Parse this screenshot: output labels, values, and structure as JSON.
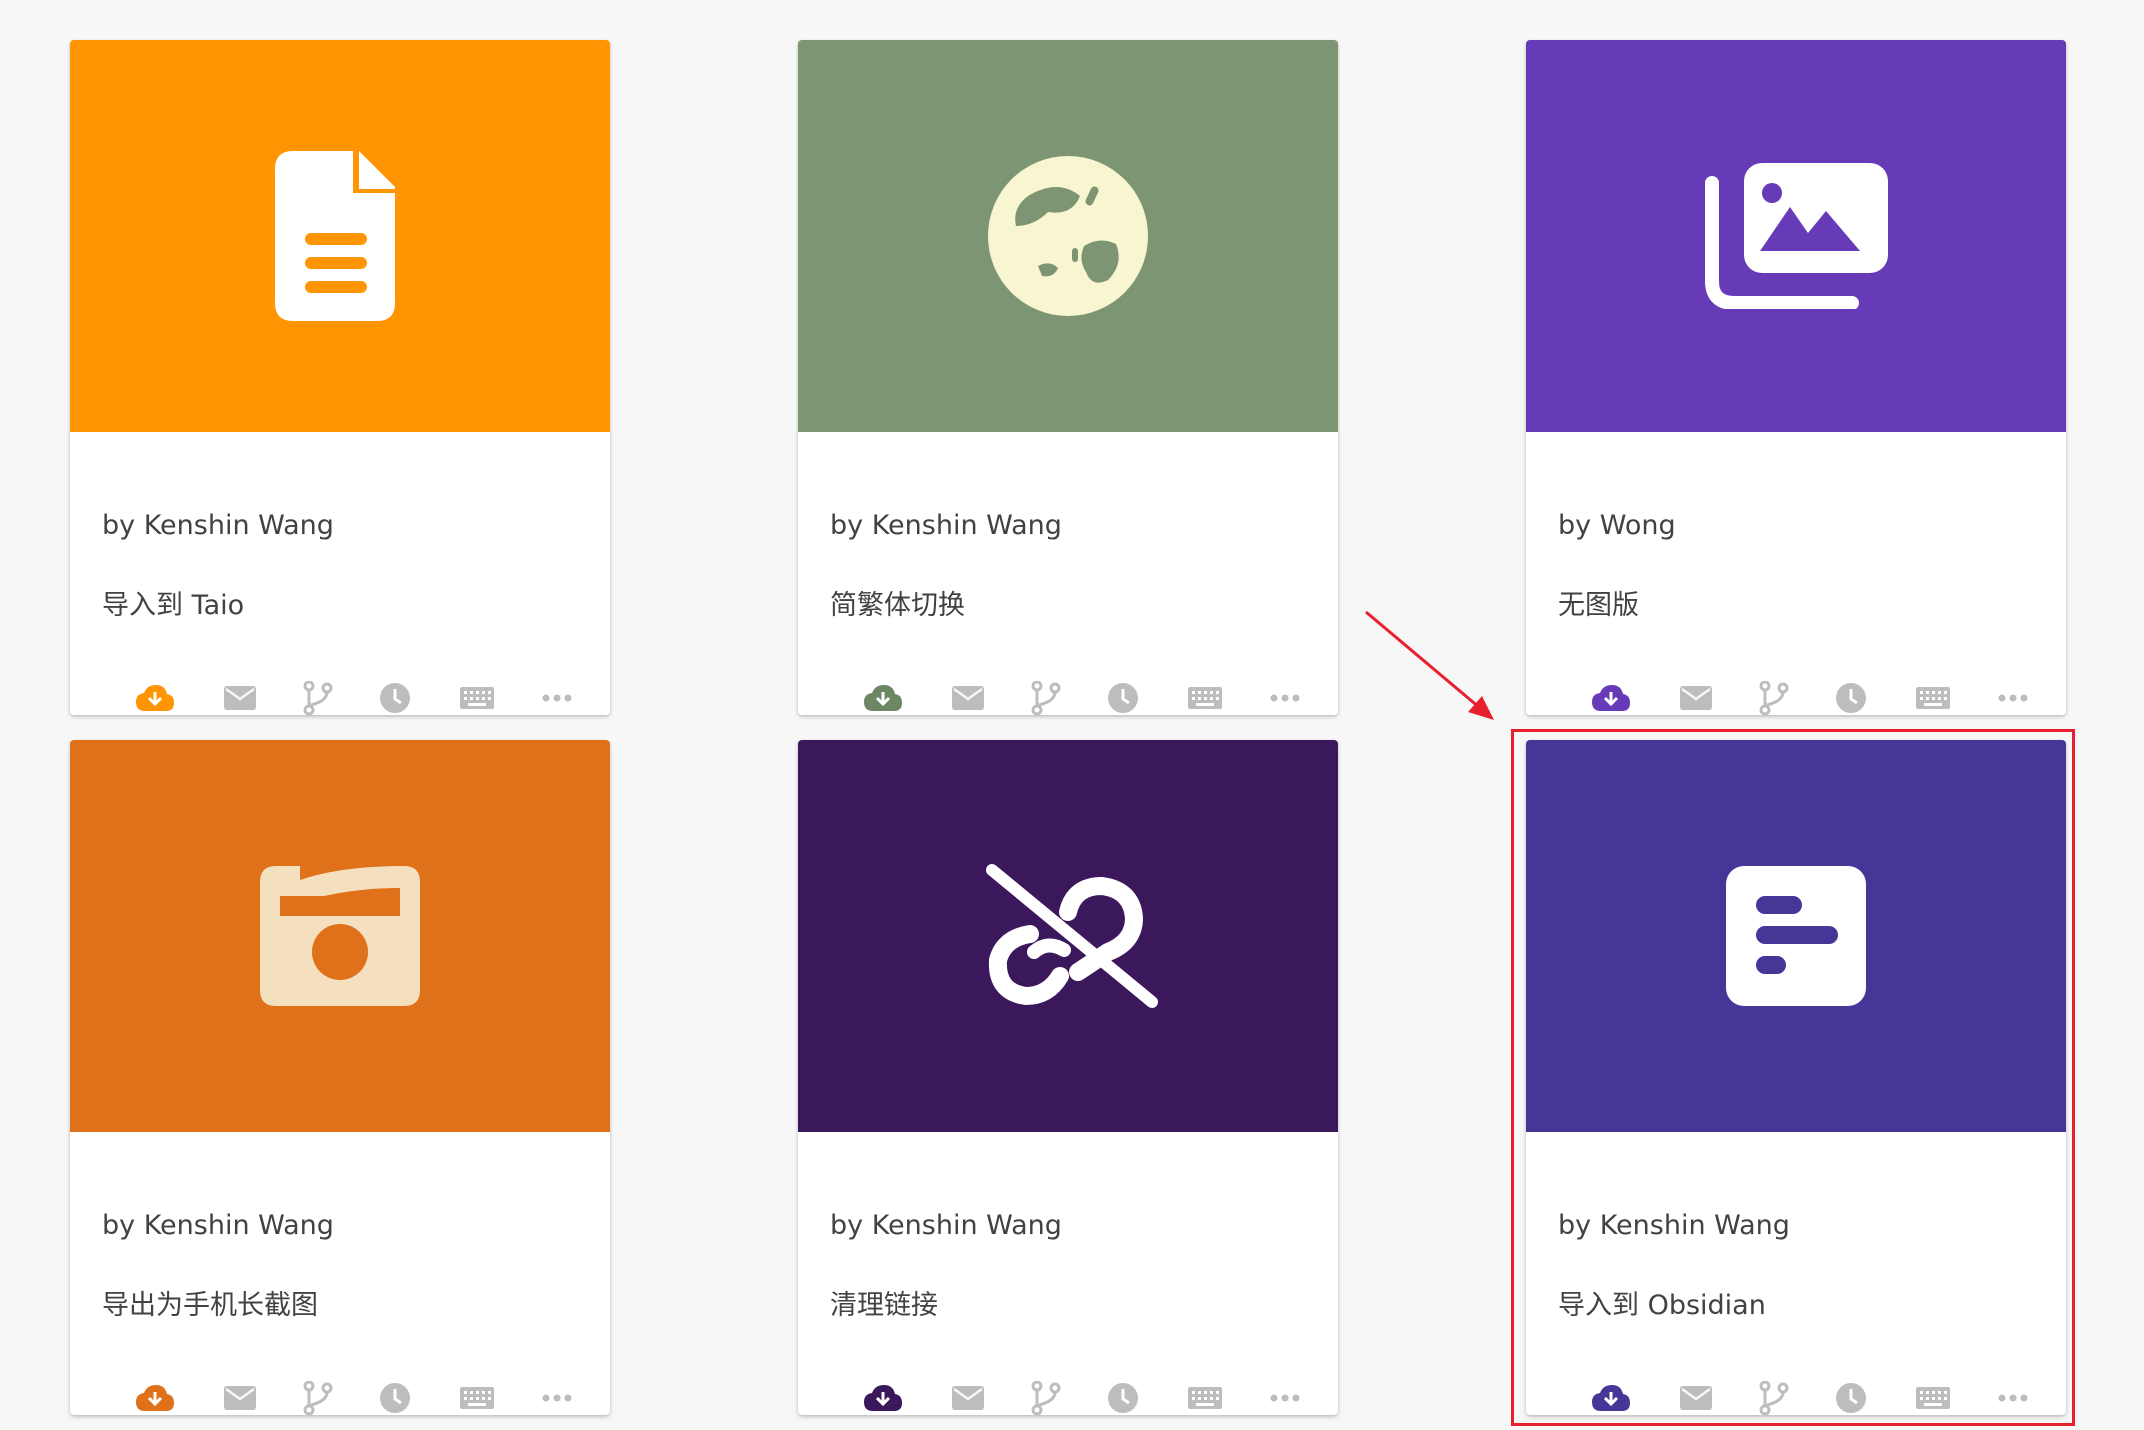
{
  "colors": {
    "highlight": "#e8202d",
    "inactive_icon": "#bdbdbd"
  },
  "cards": [
    {
      "author": "by Kenshin Wang",
      "title": "导入到 Taio",
      "banner_color": "#ff9502",
      "accent": "#ff9502",
      "icon": "document-icon",
      "icon_color": "#ffffff"
    },
    {
      "author": "by Kenshin Wang",
      "title": "简繁体切换",
      "banner_color": "#7e9574",
      "accent": "#6d8664",
      "icon": "globe-icon",
      "icon_color": "#f8f6d0"
    },
    {
      "author": "by Wong",
      "title": "无图版",
      "banner_color": "#673ab7",
      "accent": "#673ab7",
      "icon": "photo-library-icon",
      "icon_color": "#ffffff"
    },
    {
      "author": "by Kenshin Wang",
      "title": "导出为手机长截图",
      "banner_color": "#e0711b",
      "accent": "#e0711b",
      "icon": "camera-icon",
      "icon_color": "#f4dfbf"
    },
    {
      "author": "by Kenshin Wang",
      "title": "清理链接",
      "banner_color": "#3b175c",
      "accent": "#3b175c",
      "icon": "link-off-icon",
      "icon_color": "#ffffff"
    },
    {
      "author": "by Kenshin Wang",
      "title": "导入到 Obsidian",
      "banner_color": "#473698",
      "accent": "#473698",
      "icon": "obsidian-icon",
      "icon_color": "#ffffff"
    }
  ],
  "actions": [
    "cloud-download-icon",
    "mail-icon",
    "fork-icon",
    "clock-icon",
    "keyboard-icon",
    "more-icon"
  ]
}
